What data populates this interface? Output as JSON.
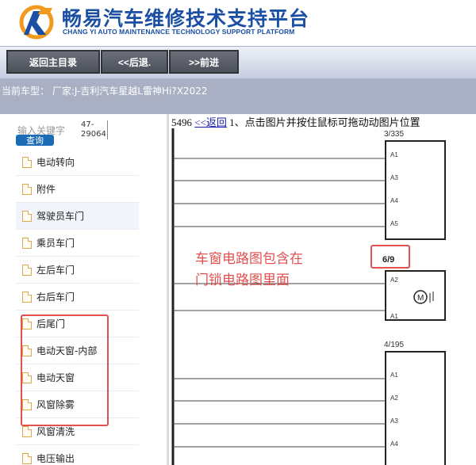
{
  "header": {
    "brand_cn": "畅易汽车维修技术支持平台",
    "brand_en": "CHANG YI AUTO MAINTENANCE TECHNOLOGY SUPPORT PLATFORM"
  },
  "toolbar": {
    "home_label": "返回主目录",
    "back_label": "<<后退.",
    "forward_label": ">>前进"
  },
  "vehicle": {
    "text": "当前车型：  厂家:J-吉利汽车星越L雷神Hi?X2022"
  },
  "sidebar": {
    "search_label": "输入关键字",
    "search_value_1": "47-",
    "search_value_2": "29064",
    "search_button": "查询",
    "items": [
      {
        "label": "电动转向"
      },
      {
        "label": "附件"
      },
      {
        "label": "驾驶员车门"
      },
      {
        "label": "乘员车门"
      },
      {
        "label": "左后车门"
      },
      {
        "label": "右后车门"
      },
      {
        "label": "后尾门"
      },
      {
        "label": "电动天窗-内部"
      },
      {
        "label": "电动天窗"
      },
      {
        "label": "风窗除雾"
      },
      {
        "label": "风窗清洗"
      },
      {
        "label": "电压输出"
      }
    ]
  },
  "main": {
    "path_id": "5496",
    "back_link": "<<返回",
    "instruction": "1、点击图片并按住鼠标可拖动动图片位置"
  },
  "diagram": {
    "connector_1": "3/335",
    "connector_2": "6/9",
    "connector_3": "4/195",
    "pins_1": [
      "A1",
      "A3",
      "A4",
      "A5"
    ],
    "pins_2": [
      "A2",
      "A1"
    ],
    "pins_3": [
      "A1",
      "A2",
      "A3",
      "A4"
    ],
    "motor_symbol": "M",
    "annotation_line1": "车窗电路图包含在",
    "annotation_line2": "门锁电路图里面"
  },
  "colors": {
    "brand_blue": "#1a4fa3",
    "highlight_red": "#e35050",
    "toolbar_button": "#5a5e68"
  }
}
